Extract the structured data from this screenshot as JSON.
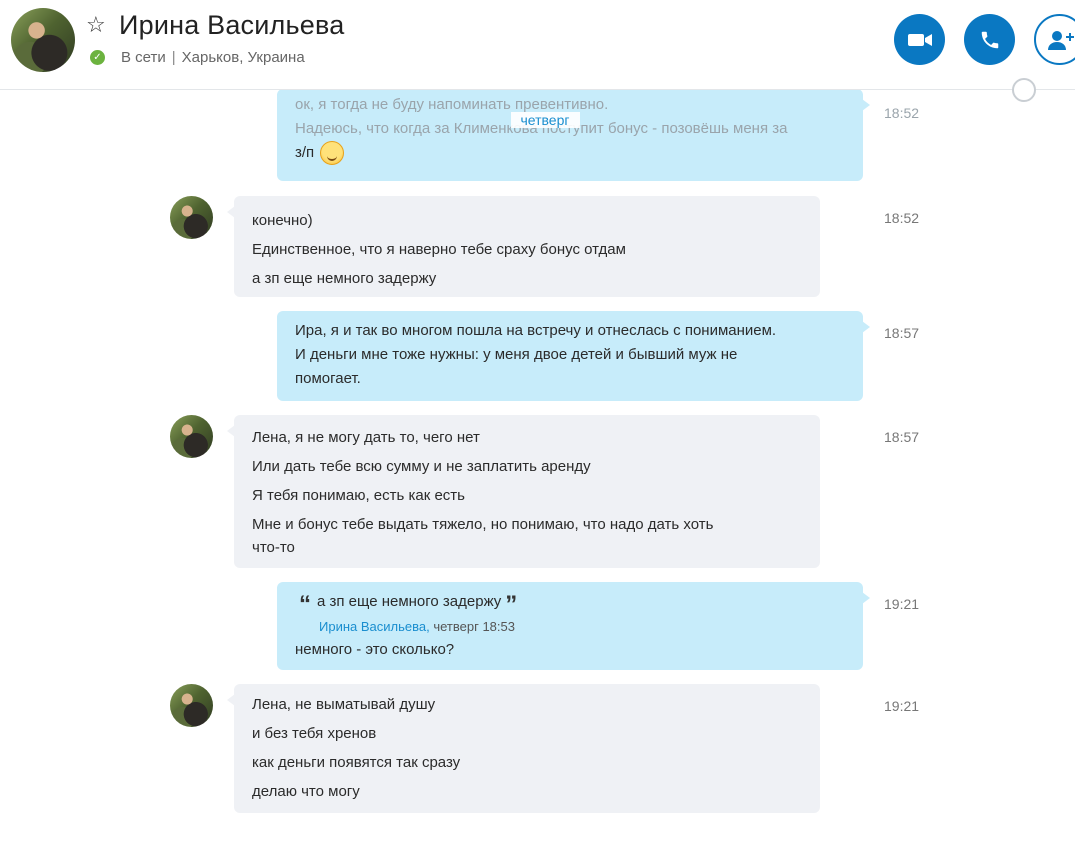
{
  "header": {
    "contact_name": "Ирина Васильева",
    "status": "В сети",
    "location": "Харьков, Украина",
    "status_color": "#6cb33f",
    "accent_color": "#0a78c2"
  },
  "day_separator": "четверг",
  "messages": [
    {
      "direction": "out",
      "lines": [
        "ок, я тогда не буду напоминать превентивно.",
        "Надеюсь, что когда за Клименкова поступит бонус - позовёшь меня за",
        "з/п"
      ],
      "time": "18:52",
      "emoji": "smile-emoji"
    },
    {
      "direction": "in",
      "lines": [
        "конечно)",
        "Единственное, что я наверно тебе сраху бонус отдам",
        "а зп еще немного задержу"
      ],
      "time": "18:52"
    },
    {
      "direction": "out",
      "lines": [
        "Ира, я и так во многом пошла на встречу и отнеслась с пониманием.",
        "И деньги мне тоже нужны: у меня двое детей и бывший муж не",
        "помогает."
      ],
      "time": "18:57"
    },
    {
      "direction": "in",
      "lines": [
        "Лена, я не могу дать то, чего нет",
        "Или дать тебе всю сумму и не заплатить аренду",
        "Я тебя понимаю, есть как есть",
        "Мне и бонус тебе выдать тяжело, но понимаю, что надо дать хоть",
        "что-то"
      ],
      "time": "18:57"
    },
    {
      "direction": "out",
      "quote": {
        "text": "а зп еще немного задержу",
        "author": "Ирина Васильева,",
        "when": "четверг 18:53"
      },
      "lines": [
        "немного - это сколько?"
      ],
      "time": "19:21"
    },
    {
      "direction": "in",
      "lines": [
        "Лена, не выматывай душу",
        "и без тебя хренов",
        "как деньги появятся так сразу",
        "делаю что могу"
      ],
      "time": "19:21"
    }
  ]
}
